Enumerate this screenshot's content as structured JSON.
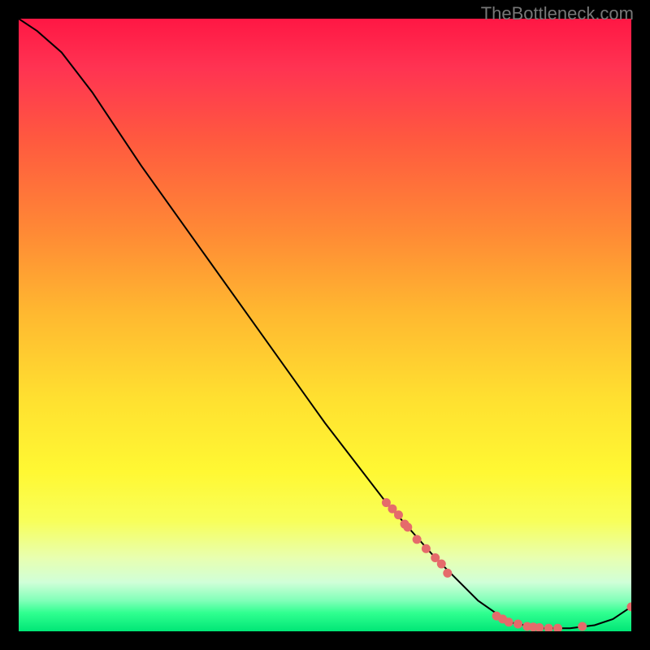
{
  "watermark": "TheBottleneck.com",
  "chart_data": {
    "type": "line",
    "title": "",
    "xlabel": "",
    "ylabel": "",
    "xlim": [
      0,
      100
    ],
    "ylim": [
      0,
      100
    ],
    "curve": [
      {
        "x": 0,
        "y": 100
      },
      {
        "x": 3,
        "y": 98
      },
      {
        "x": 7,
        "y": 94.5
      },
      {
        "x": 12,
        "y": 88
      },
      {
        "x": 20,
        "y": 76
      },
      {
        "x": 30,
        "y": 62
      },
      {
        "x": 40,
        "y": 48
      },
      {
        "x": 50,
        "y": 34
      },
      {
        "x": 60,
        "y": 21
      },
      {
        "x": 68,
        "y": 12
      },
      {
        "x": 75,
        "y": 5
      },
      {
        "x": 80,
        "y": 1.5
      },
      {
        "x": 85,
        "y": 0.5
      },
      {
        "x": 90,
        "y": 0.5
      },
      {
        "x": 94,
        "y": 1
      },
      {
        "x": 97,
        "y": 2
      },
      {
        "x": 100,
        "y": 4
      }
    ],
    "points": [
      {
        "x": 60,
        "y": 21
      },
      {
        "x": 61,
        "y": 20
      },
      {
        "x": 62,
        "y": 19
      },
      {
        "x": 63,
        "y": 17.5
      },
      {
        "x": 63.5,
        "y": 17
      },
      {
        "x": 65,
        "y": 15
      },
      {
        "x": 66.5,
        "y": 13.5
      },
      {
        "x": 68,
        "y": 12
      },
      {
        "x": 69,
        "y": 11
      },
      {
        "x": 70,
        "y": 9.5
      },
      {
        "x": 78,
        "y": 2.5
      },
      {
        "x": 79,
        "y": 2
      },
      {
        "x": 80,
        "y": 1.5
      },
      {
        "x": 81.5,
        "y": 1.2
      },
      {
        "x": 83,
        "y": 0.8
      },
      {
        "x": 84,
        "y": 0.7
      },
      {
        "x": 85,
        "y": 0.6
      },
      {
        "x": 86.5,
        "y": 0.5
      },
      {
        "x": 88,
        "y": 0.5
      },
      {
        "x": 92,
        "y": 0.8
      },
      {
        "x": 100,
        "y": 4
      }
    ],
    "point_color": "#e56b6b",
    "line_color": "#000000"
  }
}
